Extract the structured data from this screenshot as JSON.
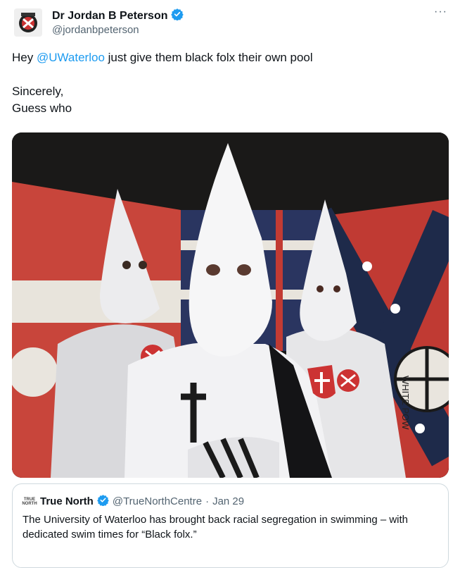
{
  "tweet": {
    "author_name": "Dr Jordan B Peterson",
    "author_handle": "@jordanbpeterson",
    "more_label": "···",
    "text_line1_before": "Hey ",
    "mention": "@UWaterloo",
    "text_line1_after": " just give them black folx their own pool",
    "text_line2": "Sincerely,",
    "text_line3": "Guess who",
    "verified_color": "#1d9bf0"
  },
  "quote": {
    "logo_line1": "TRUE",
    "logo_line2": "NORTH",
    "author_name": "True North",
    "author_handle": "@TrueNorthCentre",
    "separator": "·",
    "date": "Jan 29",
    "text": "The University of Waterloo has brought back racial segregation in swimming – with dedicated swim times for “Black folx.”"
  },
  "media": {
    "flag_text": "WHITE POW"
  }
}
